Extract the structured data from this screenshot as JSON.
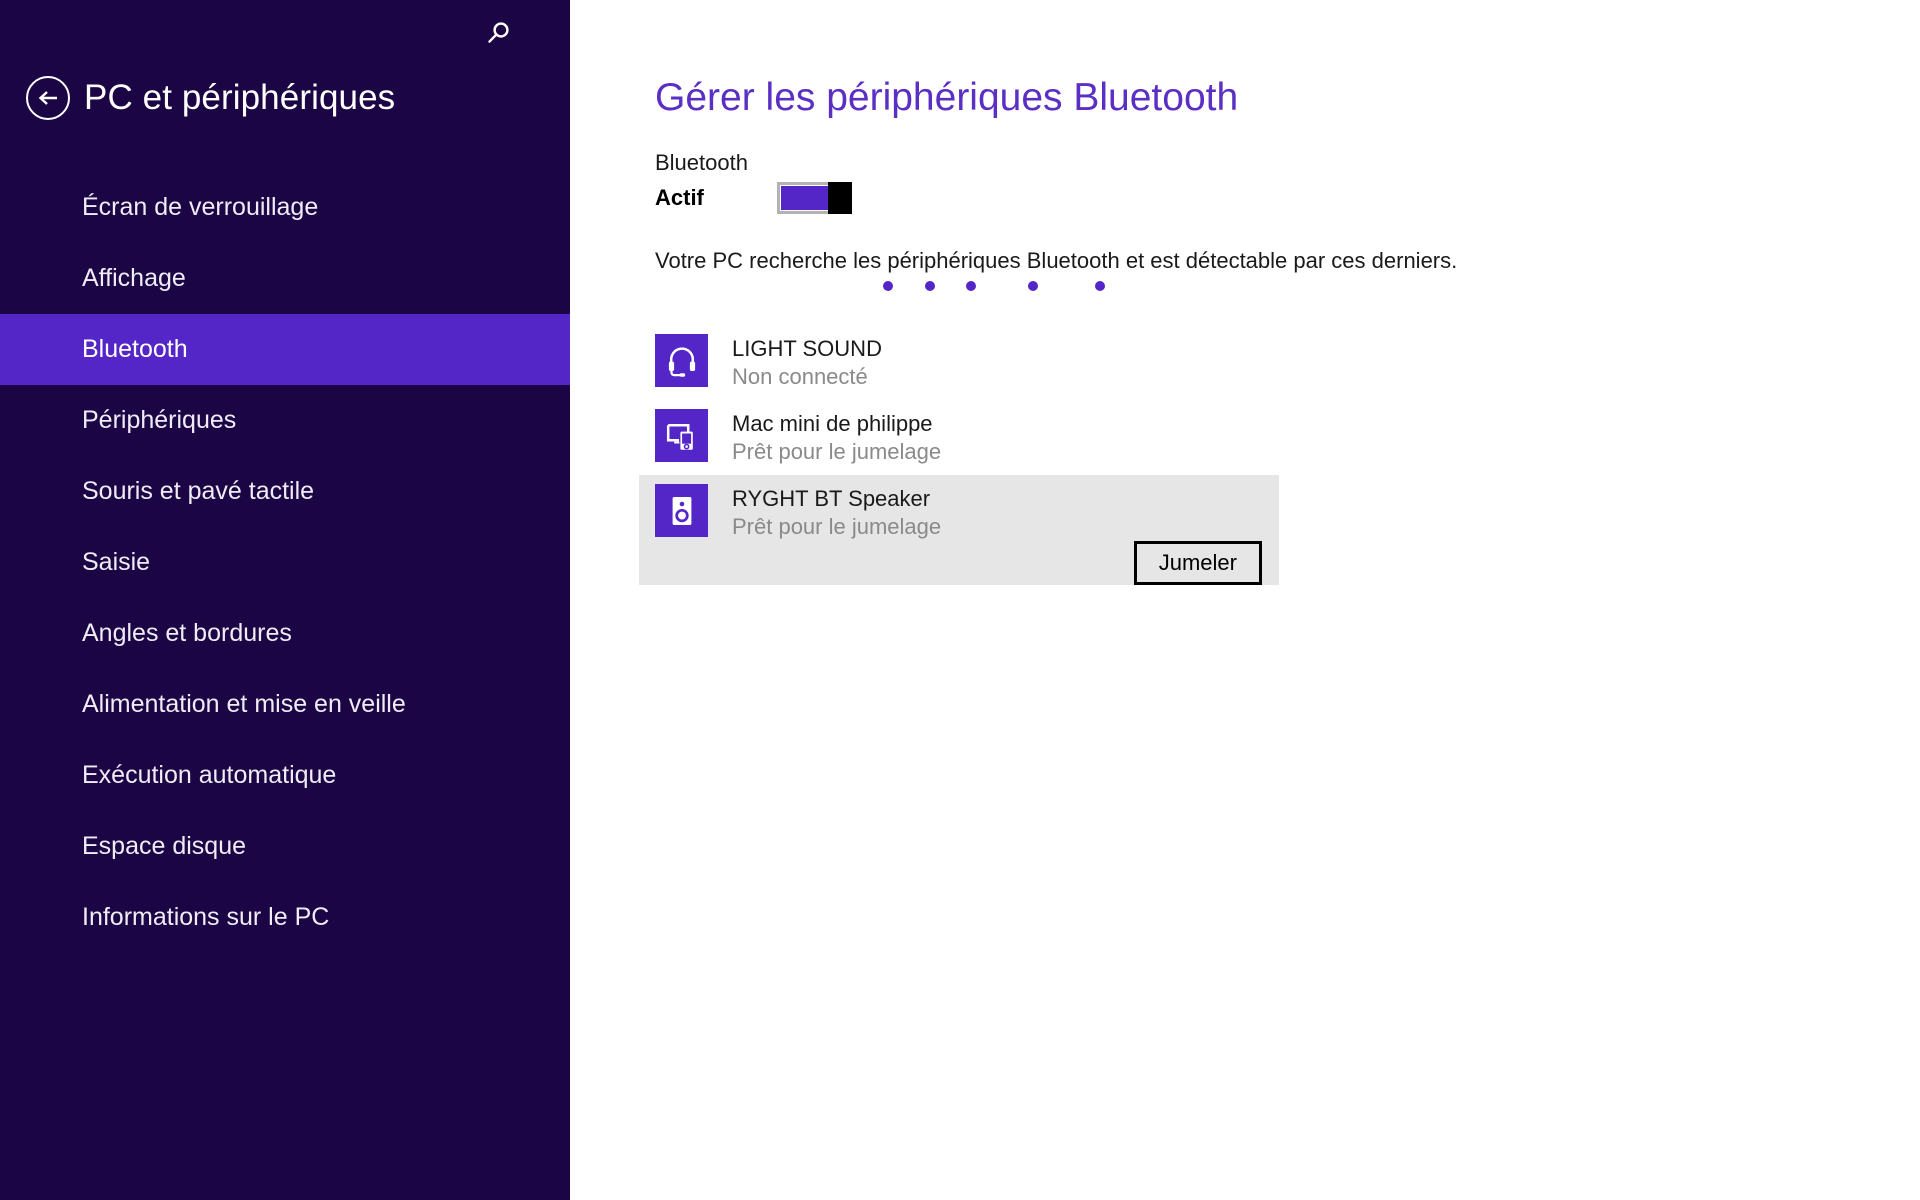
{
  "sidebar": {
    "back_icon": "back-arrow-icon",
    "title": "PC et périphériques",
    "search_icon": "search-icon",
    "selected_item": "Bluetooth",
    "items": [
      {
        "label": "Écran de verrouillage",
        "selected": false
      },
      {
        "label": "Affichage",
        "selected": false
      },
      {
        "label": "Bluetooth",
        "selected": true
      },
      {
        "label": "Périphériques",
        "selected": false
      },
      {
        "label": "Souris et pavé tactile",
        "selected": false
      },
      {
        "label": "Saisie",
        "selected": false
      },
      {
        "label": "Angles et bordures",
        "selected": false
      },
      {
        "label": "Alimentation et mise en veille",
        "selected": false
      },
      {
        "label": "Exécution automatique",
        "selected": false
      },
      {
        "label": "Espace disque",
        "selected": false
      },
      {
        "label": "Informations sur le PC",
        "selected": false
      }
    ]
  },
  "main": {
    "page_title": "Gérer les périphériques Bluetooth",
    "bluetooth_label": "Bluetooth",
    "toggle_state": "Actif",
    "toggle_on": true,
    "searching_text": "Votre PC recherche les périphériques Bluetooth et est détectable par ces derniers.",
    "progress_dots": [
      0,
      1,
      2,
      3,
      4
    ],
    "devices": [
      {
        "name": "LIGHT SOUND",
        "status": "Non connecté",
        "icon": "headset-icon",
        "selected": false,
        "action": null
      },
      {
        "name": "Mac mini de philippe",
        "status": "Prêt pour le jumelage",
        "icon": "devices-icon",
        "selected": false,
        "action": null
      },
      {
        "name": "RYGHT BT Speaker",
        "status": "Prêt pour le jumelage",
        "icon": "speaker-icon",
        "selected": true,
        "action": "Jumeler"
      }
    ]
  },
  "colors": {
    "sidebar_bg": "#1b0544",
    "accent": "#5426c8",
    "title_purple": "#5b2fc4",
    "selected_row_bg": "#e6e6e6",
    "status_gray": "#8a8a8a"
  }
}
